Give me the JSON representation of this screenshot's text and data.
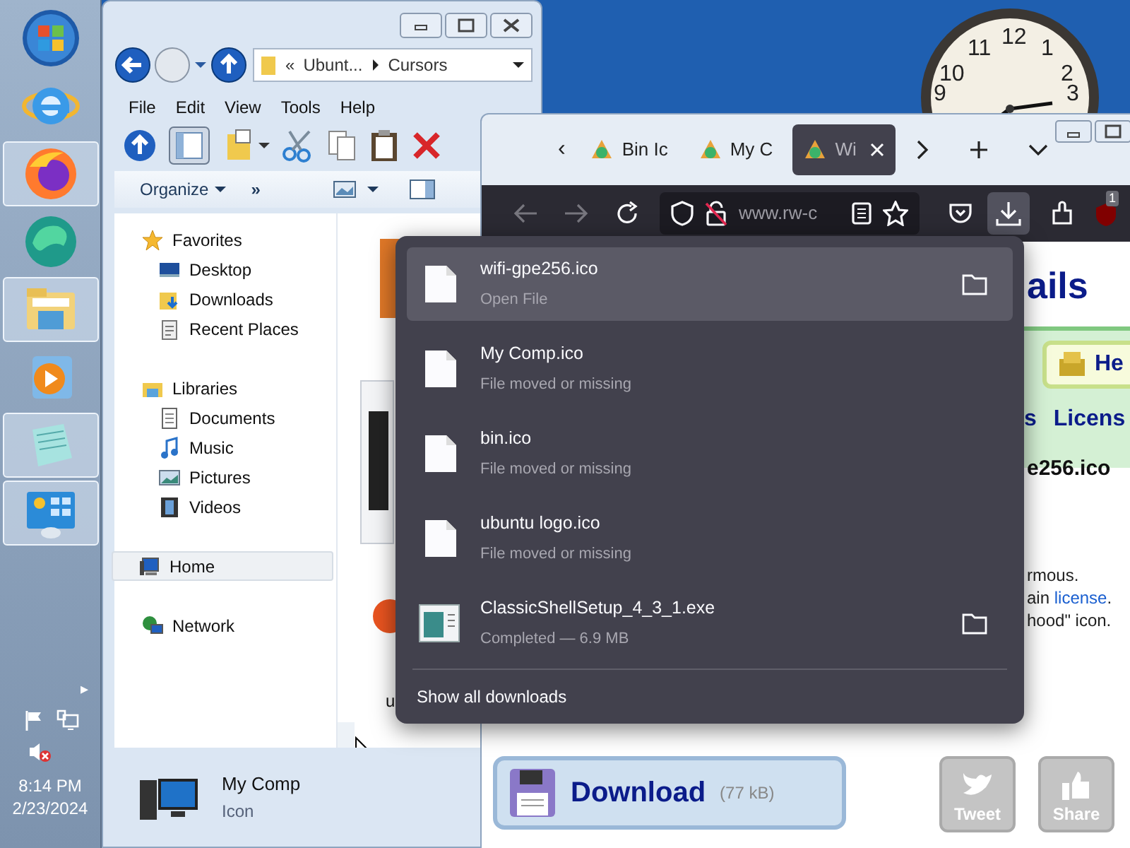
{
  "taskbar": {
    "apps": [
      {
        "kind": "start",
        "running": false
      },
      {
        "kind": "ie",
        "running": false
      },
      {
        "kind": "firefox",
        "running": true
      },
      {
        "kind": "edge",
        "running": false
      },
      {
        "kind": "explorer",
        "running": true
      },
      {
        "kind": "media",
        "running": false
      },
      {
        "kind": "notepad",
        "running": true
      },
      {
        "kind": "control",
        "running": true
      }
    ],
    "tray": {
      "expand": "▸",
      "time": "8:14 PM",
      "date": "2/23/2024"
    }
  },
  "clock": {
    "numerals": [
      "12",
      "1",
      "2",
      "3",
      "9",
      "10",
      "11"
    ]
  },
  "explorer": {
    "breadcrumb": [
      "«",
      "Ubunt...",
      "Cursors"
    ],
    "menu": [
      "File",
      "Edit",
      "View",
      "Tools",
      "Help"
    ],
    "commands": [
      {
        "kind": "menu",
        "label": "Organize"
      },
      {
        "kind": "more",
        "label": "»"
      }
    ],
    "nav": [
      {
        "kind": "favorites",
        "label": "Favorites",
        "selected": false,
        "children": [
          {
            "kind": "desktop",
            "label": "Desktop",
            "selected": false
          },
          {
            "kind": "downloads",
            "label": "Downloads",
            "selected": false
          },
          {
            "kind": "recent",
            "label": "Recent Places",
            "selected": false
          }
        ]
      },
      {
        "kind": "libraries",
        "label": "Libraries",
        "selected": false,
        "children": [
          {
            "kind": "documents",
            "label": "Documents",
            "selected": false
          },
          {
            "kind": "music",
            "label": "Music",
            "selected": false
          },
          {
            "kind": "pictures",
            "label": "Pictures",
            "selected": false
          },
          {
            "kind": "videos",
            "label": "Videos",
            "selected": false
          }
        ]
      },
      {
        "kind": "home",
        "label": "Home",
        "selected": true
      },
      {
        "kind": "network",
        "label": "Network",
        "selected": false
      }
    ],
    "content_fragment": "u",
    "details": {
      "name": "My Comp",
      "type": "Icon"
    }
  },
  "browser": {
    "tab_scroll_left": "‹",
    "tabs": [
      {
        "label": "Bin Ic",
        "selected": false
      },
      {
        "label": "My C",
        "selected": false
      },
      {
        "label": "Wi",
        "selected": true
      }
    ],
    "url": "www.rw-c",
    "extension_badge": "1",
    "page": {
      "heading": "ails",
      "help": "He",
      "nav_links": [
        "s",
        "Licens"
      ],
      "file_name": "e256.ico",
      "text_lines": [
        [
          "rmous."
        ],
        [
          "ain ",
          "license",
          "."
        ],
        [
          "hood\" icon."
        ]
      ],
      "download": {
        "label": "Download",
        "size": "(77 kB)"
      },
      "social": [
        "Tweet",
        "Share"
      ]
    }
  },
  "downloads_panel": {
    "items": [
      {
        "kind": "file",
        "name": "wifi-gpe256.ico",
        "status": "Open File",
        "selected": true,
        "folder": true
      },
      {
        "kind": "file",
        "name": "My Comp.ico",
        "status": "File moved or missing",
        "selected": false,
        "folder": false
      },
      {
        "kind": "file",
        "name": "bin.ico",
        "status": "File moved or missing",
        "selected": false,
        "folder": false
      },
      {
        "kind": "file",
        "name": "ubuntu logo.ico",
        "status": "File moved or missing",
        "selected": false,
        "folder": false
      },
      {
        "kind": "exe",
        "name": "ClassicShellSetup_4_3_1.exe",
        "status": "Completed — 6.9 MB",
        "selected": false,
        "folder": true
      }
    ],
    "footer": "Show all downloads"
  }
}
